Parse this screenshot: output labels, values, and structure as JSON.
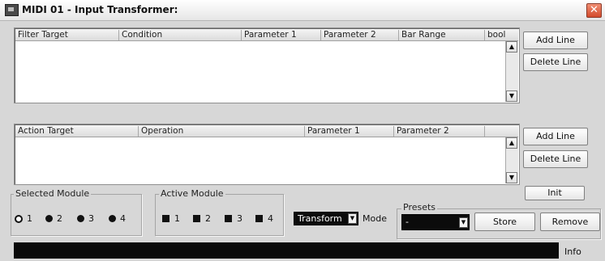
{
  "window": {
    "title": "MIDI 01 - Input Transformer:",
    "close_icon": "x-icon"
  },
  "filter_table": {
    "columns": [
      "Filter Target",
      "Condition",
      "Parameter 1",
      "Parameter 2",
      "Bar Range",
      "bool"
    ]
  },
  "action_table": {
    "columns": [
      "Action Target",
      "Operation",
      "Parameter 1",
      "Parameter 2"
    ]
  },
  "filter_buttons": {
    "add": "Add Line",
    "delete": "Delete Line"
  },
  "action_buttons": {
    "add": "Add Line",
    "delete": "Delete Line"
  },
  "init_button": "Init",
  "selected_module": {
    "label": "Selected Module",
    "options": [
      "1",
      "2",
      "3",
      "4"
    ],
    "selected": "1"
  },
  "active_module": {
    "label": "Active Module",
    "options": [
      "1",
      "2",
      "3",
      "4"
    ]
  },
  "mode": {
    "value": "Transform",
    "label": "Mode"
  },
  "presets": {
    "label": "Presets",
    "value": "-",
    "store": "Store",
    "remove": "Remove"
  },
  "info": {
    "label": "Info"
  }
}
